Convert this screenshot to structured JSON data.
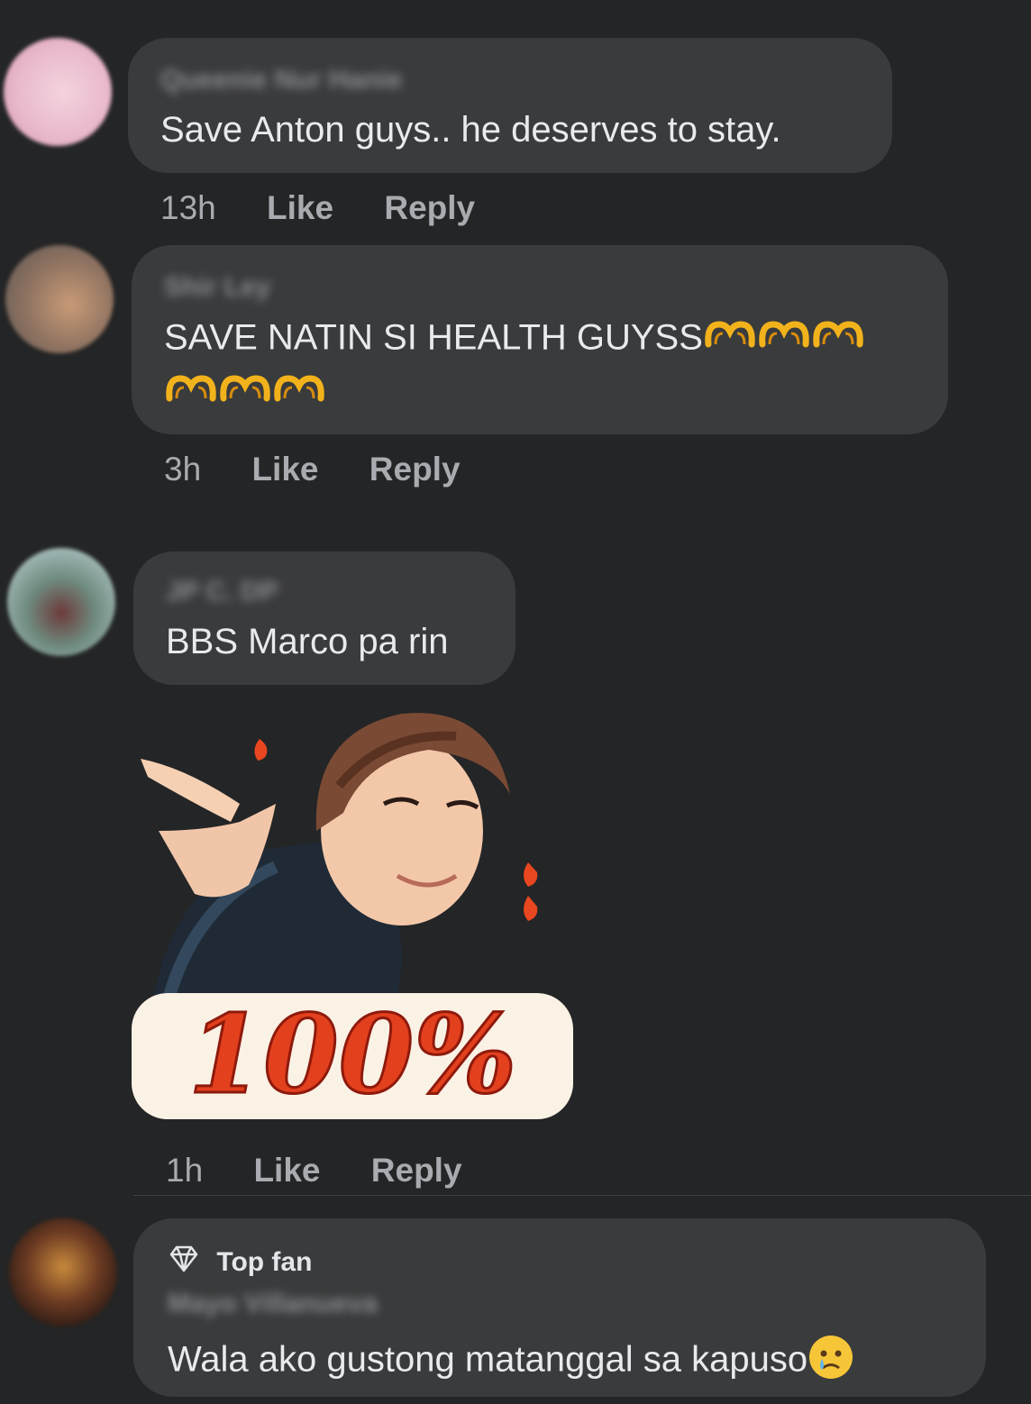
{
  "comments": [
    {
      "author": "Queenie Nur Hanie",
      "text": "Save Anton guys.. he deserves to stay.",
      "time": "13h",
      "like_label": "Like",
      "reply_label": "Reply"
    },
    {
      "author": "Shir Ley",
      "text": "SAVE NATIN SI HEALTH GUYSS",
      "emoji": "heart-hands-emoji",
      "emoji_count": 6,
      "time": "3h",
      "like_label": "Like",
      "reply_label": "Reply"
    },
    {
      "author": "JP C. DP",
      "text": "BBS Marco pa rin",
      "sticker": {
        "icon": "pointing-character-sticker",
        "text": "100%"
      },
      "time": "1h",
      "like_label": "Like",
      "reply_label": "Reply"
    },
    {
      "badge": "Top fan",
      "badge_icon": "diamond-icon",
      "author": "Mayo Villanueva",
      "text": "Wala ako gustong matanggal sa kapuso",
      "emoji": "crying-face-emoji"
    }
  ],
  "colors": {
    "background": "#242526",
    "bubble": "#3a3b3c",
    "text": "#e8eaed",
    "meta": "#a8abaf"
  }
}
